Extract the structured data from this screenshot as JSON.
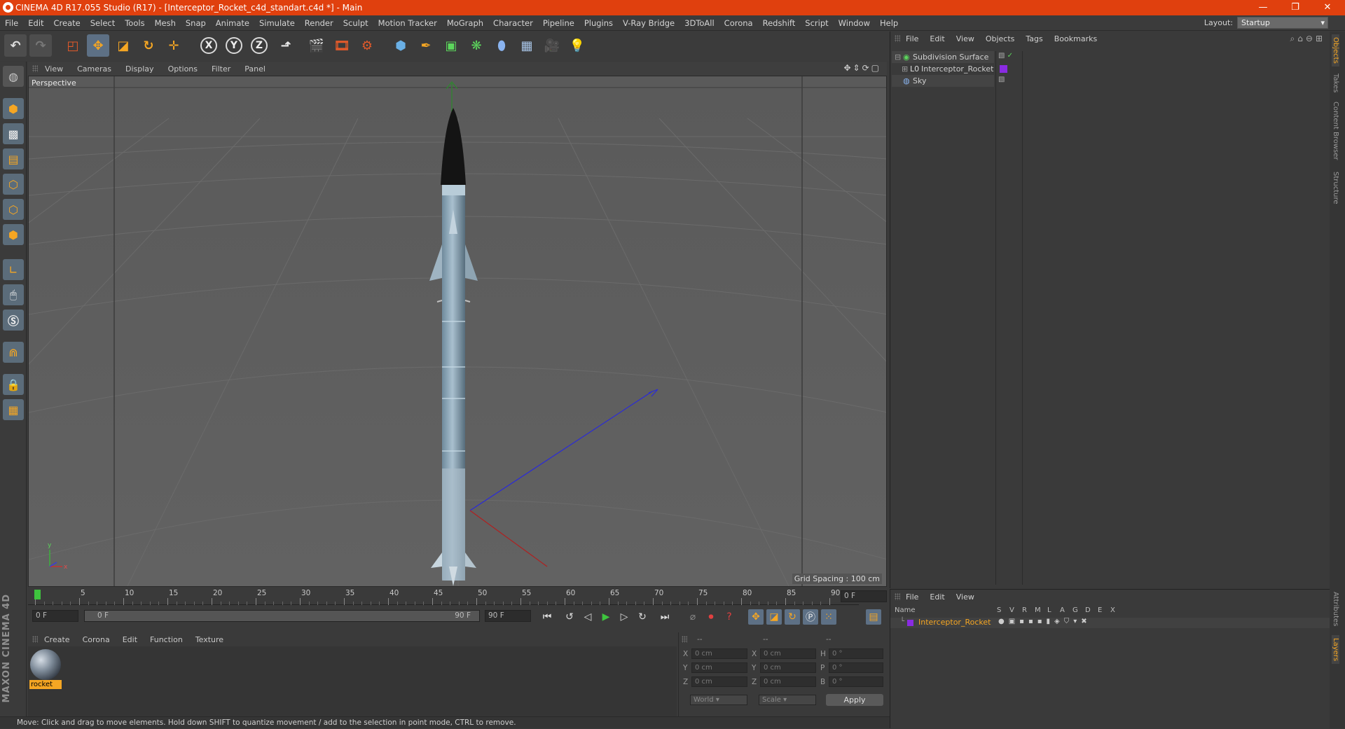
{
  "window": {
    "title": "CINEMA 4D R17.055 Studio (R17) - [Interceptor_Rocket_c4d_standart.c4d *] - Main",
    "minimize_glyph": "—",
    "restore_glyph": "❐",
    "close_glyph": "✕"
  },
  "menu": [
    "File",
    "Edit",
    "Create",
    "Select",
    "Tools",
    "Mesh",
    "Snap",
    "Animate",
    "Simulate",
    "Render",
    "Sculpt",
    "Motion Tracker",
    "MoGraph",
    "Character",
    "Pipeline",
    "Plugins",
    "V-Ray Bridge",
    "3DToAll",
    "Corona",
    "Redshift",
    "Script",
    "Window",
    "Help"
  ],
  "layout": {
    "label": "Layout:",
    "value": "Startup"
  },
  "toolbar": {
    "axis_x": "X",
    "axis_y": "Y",
    "axis_z": "Z"
  },
  "viewport": {
    "menu": [
      "View",
      "Cameras",
      "Display",
      "Options",
      "Filter",
      "Panel"
    ],
    "label": "Perspective",
    "grid_spacing": "Grid Spacing : 100 cm"
  },
  "timeline": {
    "ticks": [
      "0",
      "5",
      "10",
      "15",
      "20",
      "25",
      "30",
      "35",
      "40",
      "45",
      "50",
      "55",
      "60",
      "65",
      "70",
      "75",
      "80",
      "85",
      "90"
    ],
    "current_frame": "0 F",
    "start_field": "0 F",
    "range_start": "0 F",
    "range_end": "90 F",
    "end_field": "90 F"
  },
  "materials": {
    "menu": [
      "Create",
      "Corona",
      "Edit",
      "Function",
      "Texture"
    ],
    "items": [
      {
        "name": "rocket"
      }
    ]
  },
  "coords": {
    "headers": [
      "--",
      "--",
      "--"
    ],
    "rows": [
      {
        "a": "X",
        "v1": "0 cm",
        "b": "X",
        "v2": "0 cm",
        "c": "H",
        "v3": "0 °"
      },
      {
        "a": "Y",
        "v1": "0 cm",
        "b": "Y",
        "v2": "0 cm",
        "c": "P",
        "v3": "0 °"
      },
      {
        "a": "Z",
        "v1": "0 cm",
        "b": "Z",
        "v2": "0 cm",
        "c": "B",
        "v3": "0 °"
      }
    ],
    "world": "World",
    "scale": "Scale",
    "apply": "Apply"
  },
  "objects": {
    "menu": [
      "File",
      "Edit",
      "View",
      "Objects",
      "Tags",
      "Bookmarks"
    ],
    "items": [
      {
        "name": "Subdivision Surface"
      },
      {
        "name": "Interceptor_Rocket"
      },
      {
        "name": "Sky"
      }
    ]
  },
  "layers": {
    "menu": [
      "File",
      "Edit",
      "View"
    ],
    "header_name": "Name",
    "columns": [
      "S",
      "V",
      "R",
      "M",
      "L",
      "A",
      "G",
      "D",
      "E",
      "X"
    ],
    "items": [
      {
        "name": "Interceptor_Rocket",
        "color": "#8a2be2"
      }
    ]
  },
  "right_tabs": [
    "Objects",
    "Takes",
    "Content Browser",
    "Structure",
    "Attributes",
    "Layers"
  ],
  "status": "Move: Click and drag to move elements. Hold down SHIFT to quantize movement / add to the selection in point mode, CTRL to remove.",
  "brand": "MAXON CINEMA 4D",
  "colors": {
    "title_bar": "#e0400e",
    "accent_orange": "#f5a623",
    "layer_purple": "#8a2be2"
  }
}
